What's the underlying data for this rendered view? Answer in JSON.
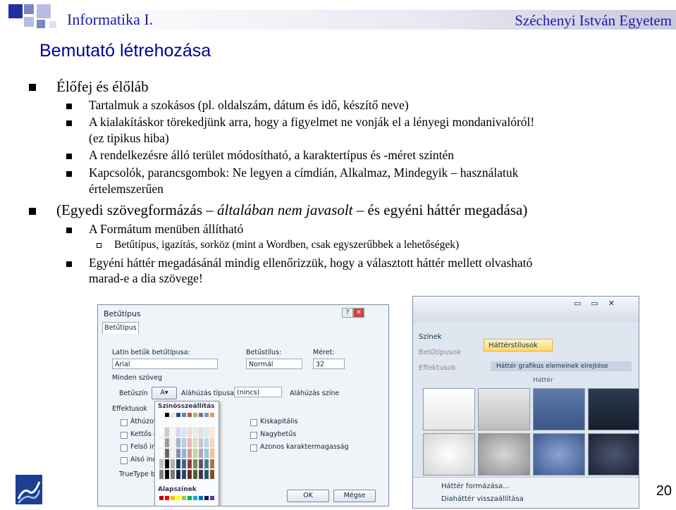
{
  "header": {
    "left": "Informatika I.",
    "right": "Széchenyi István Egyetem"
  },
  "slide": {
    "title": "Bemutató létrehozása",
    "bullets": {
      "b1": "Élőfej és élőláb",
      "b1a": "Tartalmuk a szokásos (pl. oldalszám, dátum és idő, készítő neve)",
      "b1b_line1": "A kialakításkor törekedjünk arra, hogy a figyelmet ne vonják el a lényegi mondanivalóról!",
      "b1b_line2": "(ez tipikus hiba)",
      "b1c": "A rendelkezésre álló terület módosítható, a karaktertípus és -méret szintén",
      "b1d_line1": "Kapcsolók, parancsgombok: Ne legyen a címdián, Alkalmaz, Mindegyik – használatuk",
      "b1d_line2": "értelemszerűen",
      "b2_pre": "(Egyedi szövegformázás – ",
      "b2_em": "általában nem javasolt",
      "b2_post": " – és egyéni háttér megadása)",
      "b2a": "A Formátum menüben állítható",
      "b2a1": "Betűtípus, igazítás, sorköz (mint a Wordben, csak egyszerűbbek a lehetőségek)",
      "b2b_line1": "Egyéni háttér megadásánál mindig ellenőrizzük, hogy a választott háttér mellett olvasható",
      "b2b_line2": "marad-e a dia szövege!"
    },
    "page_number": "20"
  },
  "font_dialog": {
    "title": "Betűtípus",
    "tab": "Betűtípus",
    "latin_label": "Latin betűk betűtípusa:",
    "latin_value": "Arial",
    "style_label": "Betűstílus:",
    "style_value": "Normál",
    "size_label": "Méret:",
    "size_value": "32",
    "all_text": "Minden szöveg",
    "font_color": "Betűszín",
    "underline_style": "Aláhúzás típusa",
    "underline_value": "(nincs)",
    "underline_color": "Aláhúzás színe",
    "effects": "Effektusok",
    "strike": "Áthúzott",
    "double_strike": "Kettős áthúzás",
    "superscript": "Felső index",
    "subscript": "Alsó index",
    "small_caps": "Kiskapitális",
    "all_caps": "Nagybetűs",
    "equalize": "Azonos karaktermagasság",
    "truetype": "TrueType b",
    "ok": "OK",
    "cancel": "Mégse",
    "palette_theme": "Színösszeállítás",
    "palette_std": "Alapszínek"
  },
  "background_gallery": {
    "colors": "Színek",
    "fonts": "Betűtípusok",
    "effects": "Effektusok",
    "bg_styles": "Háttérstílusok",
    "hide_graphics": "Háttér grafikus elemeinek elrejtése",
    "section": "Háttér",
    "format_bg": "Háttér formázása...",
    "reset_bg": "Diaháttér visszaállítása"
  }
}
